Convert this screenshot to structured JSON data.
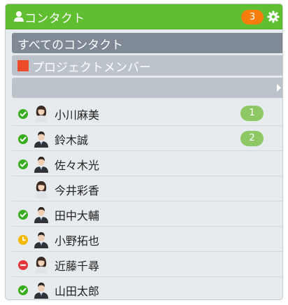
{
  "header": {
    "title": "コンタクト",
    "unread_count": "3",
    "icon": "person-icon",
    "settings_icon": "gear-icon",
    "color": "#5fbf31"
  },
  "groups": {
    "all": {
      "label": "すべてのコンタクト"
    },
    "project": {
      "label": "プロジェクトメンバー",
      "color": "#ee4b2b"
    }
  },
  "contacts": [
    {
      "name": "小川麻美",
      "status": "online",
      "count": "1",
      "avatar": "female-avatar"
    },
    {
      "name": "鈴木誠",
      "status": "online",
      "count": "2",
      "avatar": "male-avatar"
    },
    {
      "name": "佐々木光",
      "status": "online",
      "count": "",
      "avatar": "male-avatar"
    },
    {
      "name": "今井彩香",
      "status": "none",
      "count": "",
      "avatar": "female-avatar"
    },
    {
      "name": "田中大輔",
      "status": "online",
      "count": "",
      "avatar": "male-avatar"
    },
    {
      "name": "小野拓也",
      "status": "away",
      "count": "",
      "avatar": "male-avatar"
    },
    {
      "name": "近藤千尋",
      "status": "busy",
      "count": "",
      "avatar": "female-avatar"
    },
    {
      "name": "山田太郎",
      "status": "online",
      "count": "",
      "avatar": "male-avatar"
    }
  ],
  "status_colors": {
    "online": "#3aac1f",
    "away": "#f5b800",
    "busy": "#e2383c"
  }
}
